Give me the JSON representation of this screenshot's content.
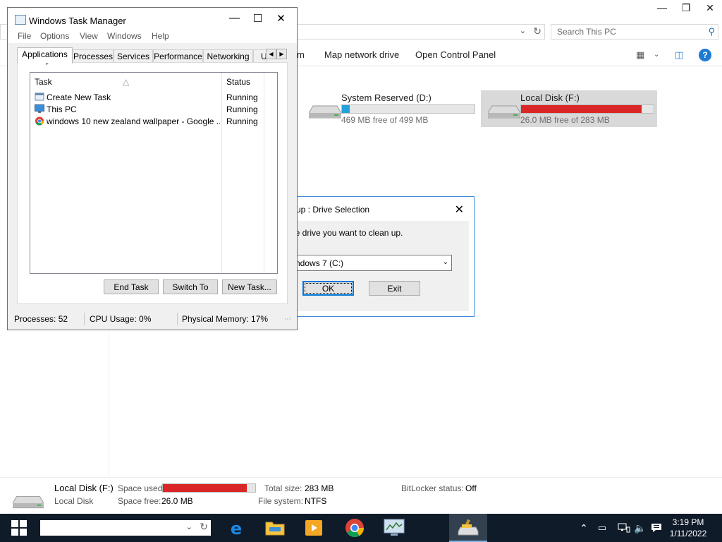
{
  "explorer": {
    "caption_buttons": [
      "—",
      "❒",
      "✕"
    ],
    "search_placeholder": "Search This PC",
    "ribbon": {
      "partial_cmd": "m",
      "map_network_drive": "Map network drive",
      "open_control_panel": "Open Control Panel"
    },
    "drives": [
      {
        "name": "System Reserved (D:)",
        "free": "469 MB free of 499 MB",
        "used_fraction": 0.06,
        "color": "#26a0da"
      },
      {
        "name": "Local Disk (F:)",
        "free": "26.0 MB free of 283 MB",
        "used_fraction": 0.91,
        "color": "#da2626"
      }
    ],
    "details": {
      "name": "Local Disk (F:)",
      "type": "Local Disk",
      "space_used_label": "Space used:",
      "space_used_fraction": 0.91,
      "space_free_label": "Space free:",
      "space_free": "26.0 MB",
      "total_size_label": "Total size:",
      "total_size": "283 MB",
      "file_system_label": "File system:",
      "file_system": "NTFS",
      "bitlocker_label": "BitLocker status:",
      "bitlocker": "Off"
    }
  },
  "cleanup": {
    "title": "up : Drive Selection",
    "prompt": "he drive you want to clean up.",
    "selected_drive": "ndows 7 (C:)",
    "ok": "OK",
    "exit": "Exit"
  },
  "taskmgr": {
    "title": "Windows Task Manager",
    "menu": [
      "File",
      "Options",
      "View",
      "Windows",
      "Help"
    ],
    "tabs": [
      "Applications",
      "Processes",
      "Services",
      "Performance",
      "Networking",
      "U"
    ],
    "columns": {
      "task": "Task",
      "status": "Status"
    },
    "rows": [
      {
        "task": "Create New Task",
        "status": "Running"
      },
      {
        "task": "This PC",
        "status": "Running"
      },
      {
        "task": "windows 10 new zealand wallpaper - Google ...",
        "status": "Running"
      }
    ],
    "buttons": {
      "end_task": "End Task",
      "switch_to": "Switch To",
      "new_task": "New Task..."
    },
    "status": {
      "processes": "Processes: 52",
      "cpu": "CPU Usage: 0%",
      "memory": "Physical Memory: 17%"
    }
  },
  "taskbar": {
    "time": "3:19 PM",
    "date": "1/11/2022"
  },
  "colors": {
    "taskbar": "#101b2a",
    "accent": "#0078d7",
    "used_red": "#da2626",
    "used_blue": "#26a0da"
  }
}
